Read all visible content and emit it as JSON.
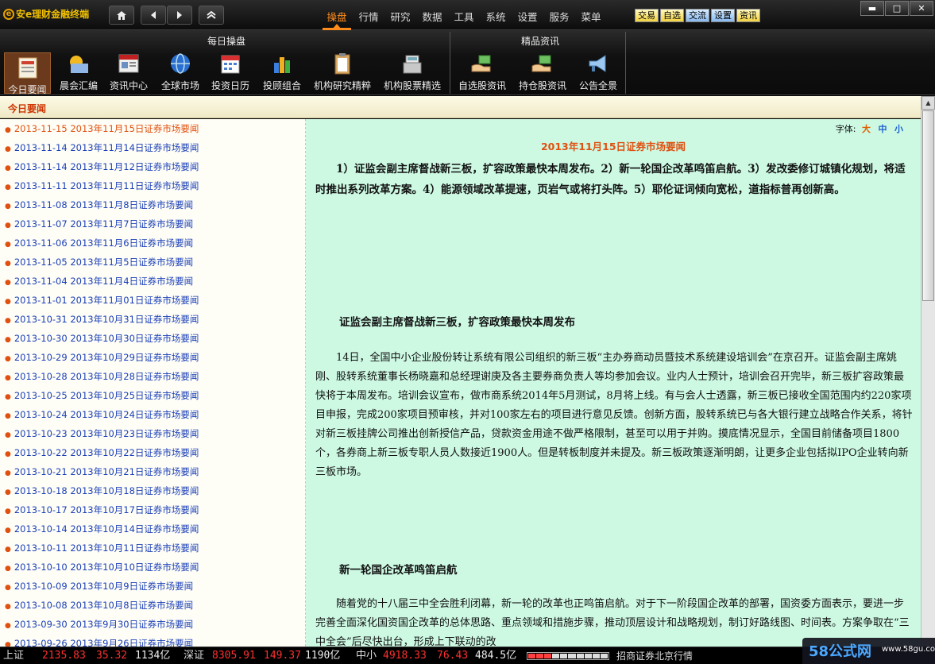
{
  "app": {
    "title": "安e理财金融终端"
  },
  "nav_buttons": [
    "home",
    "back",
    "forward",
    "up"
  ],
  "menu": {
    "items": [
      "操盘",
      "行情",
      "研究",
      "数据",
      "工具",
      "系统",
      "设置",
      "服务",
      "菜单"
    ],
    "active": "操盘"
  },
  "quick_buttons": [
    "交易",
    "自选",
    "交流",
    "设置",
    "资讯"
  ],
  "window_controls": [
    "▬",
    "□",
    "✕"
  ],
  "toolbar": {
    "group1_title": "每日操盘",
    "group2_title": "精品资讯",
    "tools": [
      {
        "label": "今日要闻",
        "icon": "newspaper-icon",
        "active": true
      },
      {
        "label": "晨会汇编",
        "icon": "sunrise-icon"
      },
      {
        "label": "资讯中心",
        "icon": "news-icon"
      },
      {
        "label": "全球市场",
        "icon": "globe-icon"
      },
      {
        "label": "投资日历",
        "icon": "calendar-icon"
      },
      {
        "label": "投顾组合",
        "icon": "portfolio-chart-icon"
      },
      {
        "label": "机构研究精粹",
        "icon": "clipboard-icon"
      },
      {
        "label": "机构股票精选",
        "icon": "cash-register-icon"
      },
      {
        "label": "自选股资讯",
        "icon": "hand-money-icon"
      },
      {
        "label": "持仓股资讯",
        "icon": "hand-money-icon"
      },
      {
        "label": "公告全景",
        "icon": "megaphone-icon"
      }
    ]
  },
  "section": {
    "title": "今日要闻"
  },
  "news_list": [
    {
      "date": "2013-11-15",
      "title": "2013年11月15日证券市场要闻"
    },
    {
      "date": "2013-11-14",
      "title": "2013年11月14日证券市场要闻"
    },
    {
      "date": "2013-11-14",
      "title": "2013年11月12日证券市场要闻"
    },
    {
      "date": "2013-11-11",
      "title": "2013年11月11日证券市场要闻"
    },
    {
      "date": "2013-11-08",
      "title": "2013年11月8日证券市场要闻"
    },
    {
      "date": "2013-11-07",
      "title": "2013年11月7日证券市场要闻"
    },
    {
      "date": "2013-11-06",
      "title": "2013年11月6日证券市场要闻"
    },
    {
      "date": "2013-11-05",
      "title": "2013年11月5日证券市场要闻"
    },
    {
      "date": "2013-11-04",
      "title": "2013年11月4日证券市场要闻"
    },
    {
      "date": "2013-11-01",
      "title": "2013年11月01日证券市场要闻"
    },
    {
      "date": "2013-10-31",
      "title": "2013年10月31日证券市场要闻"
    },
    {
      "date": "2013-10-30",
      "title": "2013年10月30日证券市场要闻"
    },
    {
      "date": "2013-10-29",
      "title": "2013年10月29日证券市场要闻"
    },
    {
      "date": "2013-10-28",
      "title": "2013年10月28日证券市场要闻"
    },
    {
      "date": "2013-10-25",
      "title": "2013年10月25日证券市场要闻"
    },
    {
      "date": "2013-10-24",
      "title": "2013年10月24日证券市场要闻"
    },
    {
      "date": "2013-10-23",
      "title": "2013年10月23日证券市场要闻"
    },
    {
      "date": "2013-10-22",
      "title": "2013年10月22日证券市场要闻"
    },
    {
      "date": "2013-10-21",
      "title": "2013年10月21日证券市场要闻"
    },
    {
      "date": "2013-10-18",
      "title": "2013年10月18日证券市场要闻"
    },
    {
      "date": "2013-10-17",
      "title": "2013年10月17日证券市场要闻"
    },
    {
      "date": "2013-10-14",
      "title": "2013年10月14日证券市场要闻"
    },
    {
      "date": "2013-10-11",
      "title": "2013年10月11日证券市场要闻"
    },
    {
      "date": "2013-10-10",
      "title": "2013年10月10日证券市场要闻"
    },
    {
      "date": "2013-10-09",
      "title": "2013年10月9日证券市场要闻"
    },
    {
      "date": "2013-10-08",
      "title": "2013年10月8日证券市场要闻"
    },
    {
      "date": "2013-09-30",
      "title": "2013年9月30日证券市场要闻"
    },
    {
      "date": "2013-09-26",
      "title": "2013年9月26日证券市场要闻"
    }
  ],
  "article": {
    "font_label": "字体:",
    "font_big": "大",
    "font_mid": "中",
    "font_small": "小",
    "title": "2013年11月15日证券市场要闻",
    "summary": "1）证监会副主席督战新三板，扩容政策最快本周发布。2）新一轮国企改革鸣笛启航。3）发改委修订城镇化规划，将适时推出系列改革方案。4）能源领域改革提速，页岩气或将打头阵。5）耶伦证词倾向宽松，道指标普再创新高。",
    "section1_title": "证监会副主席督战新三板，扩容政策最快本周发布",
    "section1_body": "14日，全国中小企业股份转让系统有限公司组织的新三板“主办券商动员暨技术系统建设培训会”在京召开。证监会副主席姚刚、股转系统董事长杨晓嘉和总经理谢庚及各主要券商负责人等均参加会议。业内人士预计，培训会召开完毕，新三板扩容政策最快将于本周发布。培训会议宣布，做市商系统2014年5月测试，8月将上线。有与会人士透露，新三板已接收全国范围内约220家项目申报，完成200家项目预审核，并对100家左右的项目进行意见反馈。创新方面，股转系统已与各大银行建立战略合作关系，将针对新三板挂牌公司推出创新授信产品，贷款资金用途不做严格限制，甚至可以用于并购。摸底情况显示，全国目前储备项目1800个，各券商上新三板专职人员人数接近1900人。但是转板制度并未提及。新三板政策逐渐明朗，让更多企业包括拟IPO企业转向新三板市场。",
    "section2_title": "新一轮国企改革鸣笛启航",
    "section2_body": "随着党的十八届三中全会胜利闭幕，新一轮的改革也正鸣笛启航。对于下一阶段国企改革的部署，国资委方面表示，要进一步完善全面深化国资国企改革的总体思路、重点领域和措施步骤，推动顶层设计和战略规划，制订好路线图、时间表。方案争取在“三中全会”后尽快出台，形成上下联动的改"
  },
  "statusbar": {
    "sh_label": "上证",
    "sh_value": "2135.83",
    "sh_change": "35.32",
    "sh_volume": "1134亿",
    "sz_label": "深证",
    "sz_value": "8305.91",
    "sz_change": "149.37",
    "sz_volume": "1190亿",
    "sme_label": "中小",
    "sme_value": "4918.33",
    "sme_change": "76.43",
    "sme_volume": "484.5亿",
    "broker": "招商证券北京行情"
  },
  "watermark": {
    "text": "58公式网",
    "url": "www.58gu.com"
  }
}
